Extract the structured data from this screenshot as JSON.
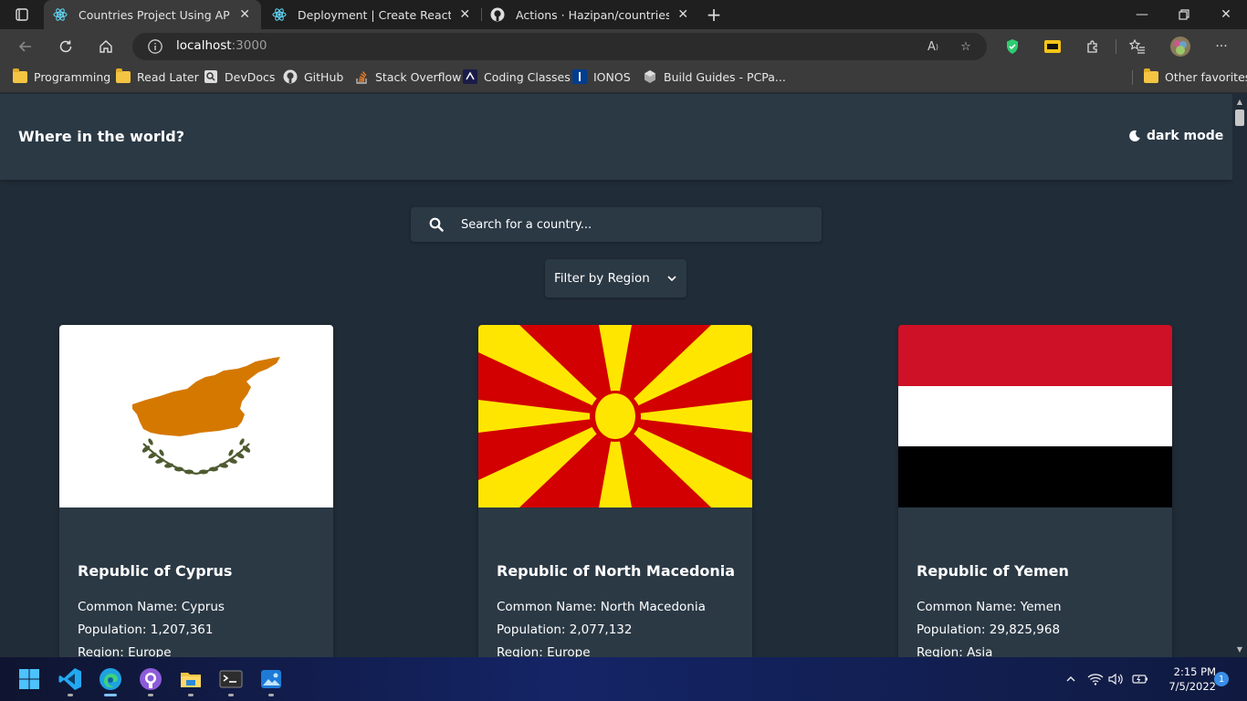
{
  "browser": {
    "tabs": [
      {
        "title": "Countries Project Using API",
        "active": true,
        "icon": "react-icon"
      },
      {
        "title": "Deployment | Create React App",
        "active": false,
        "icon": "react-icon"
      },
      {
        "title": "Actions · Hazipan/countries-proj",
        "active": false,
        "icon": "github-icon"
      }
    ],
    "address": {
      "host": "localhost",
      "port": ":3000"
    },
    "favorites": [
      {
        "label": "Programming",
        "icon": "folder-icon"
      },
      {
        "label": "Read Later",
        "icon": "folder-icon"
      },
      {
        "label": "DevDocs",
        "icon": "devdocs-icon"
      },
      {
        "label": "GitHub",
        "icon": "github-icon"
      },
      {
        "label": "Stack Overflow",
        "icon": "stackoverflow-icon"
      },
      {
        "label": "Coding Classes",
        "icon": "coding-classes-icon"
      },
      {
        "label": "IONOS",
        "icon": "ionos-icon"
      },
      {
        "label": "Build Guides - PCPa...",
        "icon": "pcpartpicker-icon"
      },
      {
        "label": "Other favorites",
        "icon": "folder-icon"
      }
    ]
  },
  "app": {
    "title": "Where in the world?",
    "mode_label": "dark mode",
    "search_placeholder": "Search for a country...",
    "filter_label": "Filter by Region"
  },
  "countries": [
    {
      "official": "Republic of Cyprus",
      "common_label": "Common Name:",
      "common": "Cyprus",
      "population_label": "Population:",
      "population": "1,207,361",
      "region_label": "Region:",
      "region": "Europe",
      "flag": "cyprus-flag"
    },
    {
      "official": "Republic of North Macedonia",
      "common_label": "Common Name:",
      "common": "North Macedonia",
      "population_label": "Population:",
      "population": "2,077,132",
      "region_label": "Region:",
      "region": "Europe",
      "flag": "north-macedonia-flag"
    },
    {
      "official": "Republic of Yemen",
      "common_label": "Common Name:",
      "common": "Yemen",
      "population_label": "Population:",
      "population": "29,825,968",
      "region_label": "Region:",
      "region": "Asia",
      "flag": "yemen-flag"
    }
  ],
  "taskbar": {
    "time": "2:15 PM",
    "date": "7/5/2022",
    "notifications": "1"
  },
  "colors": {
    "page_bg": "#202c37",
    "element_bg": "#2b3945",
    "text": "#ffffff"
  }
}
